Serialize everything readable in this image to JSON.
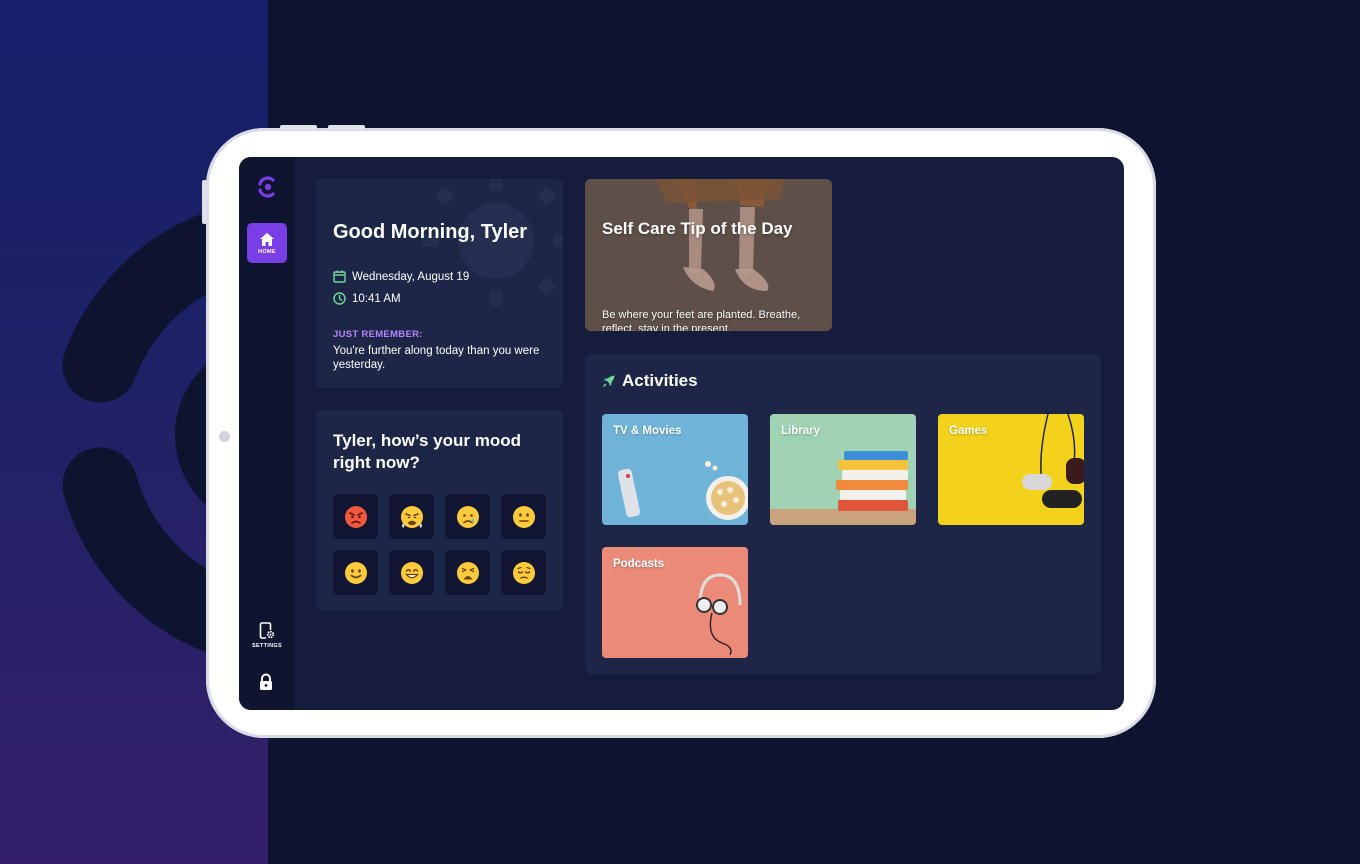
{
  "sidebar": {
    "home_label": "HOME",
    "settings_label": "SETTINGS"
  },
  "greeting": {
    "title": "Good Morning, Tyler",
    "date": "Wednesday, August 19",
    "time": "10:41 AM",
    "remember_title": "JUST REMEMBER:",
    "remember_text": "You're further along today than you were yesterday."
  },
  "mood": {
    "question": "Tyler, how’s your mood right now?",
    "options": [
      "😡",
      "😤",
      "😢",
      "😐",
      "🙂",
      "😁",
      "😩",
      "😔"
    ]
  },
  "tip": {
    "title": "Self Care Tip of the Day",
    "text": "Be where your feet are planted. Breathe, reflect, stay in the present."
  },
  "activities": {
    "title": "Activities",
    "tiles": [
      {
        "label": "TV & Movies",
        "color": "#6fb3d9"
      },
      {
        "label": "Library",
        "color": "#9fd3b4"
      },
      {
        "label": "Games",
        "color": "#f2d21a"
      },
      {
        "label": "Podcasts",
        "color": "#ec8a7a"
      }
    ]
  },
  "colors": {
    "accent": "#7a3ee6",
    "remember": "#b584ff",
    "icon_green": "#6fdc9a"
  }
}
